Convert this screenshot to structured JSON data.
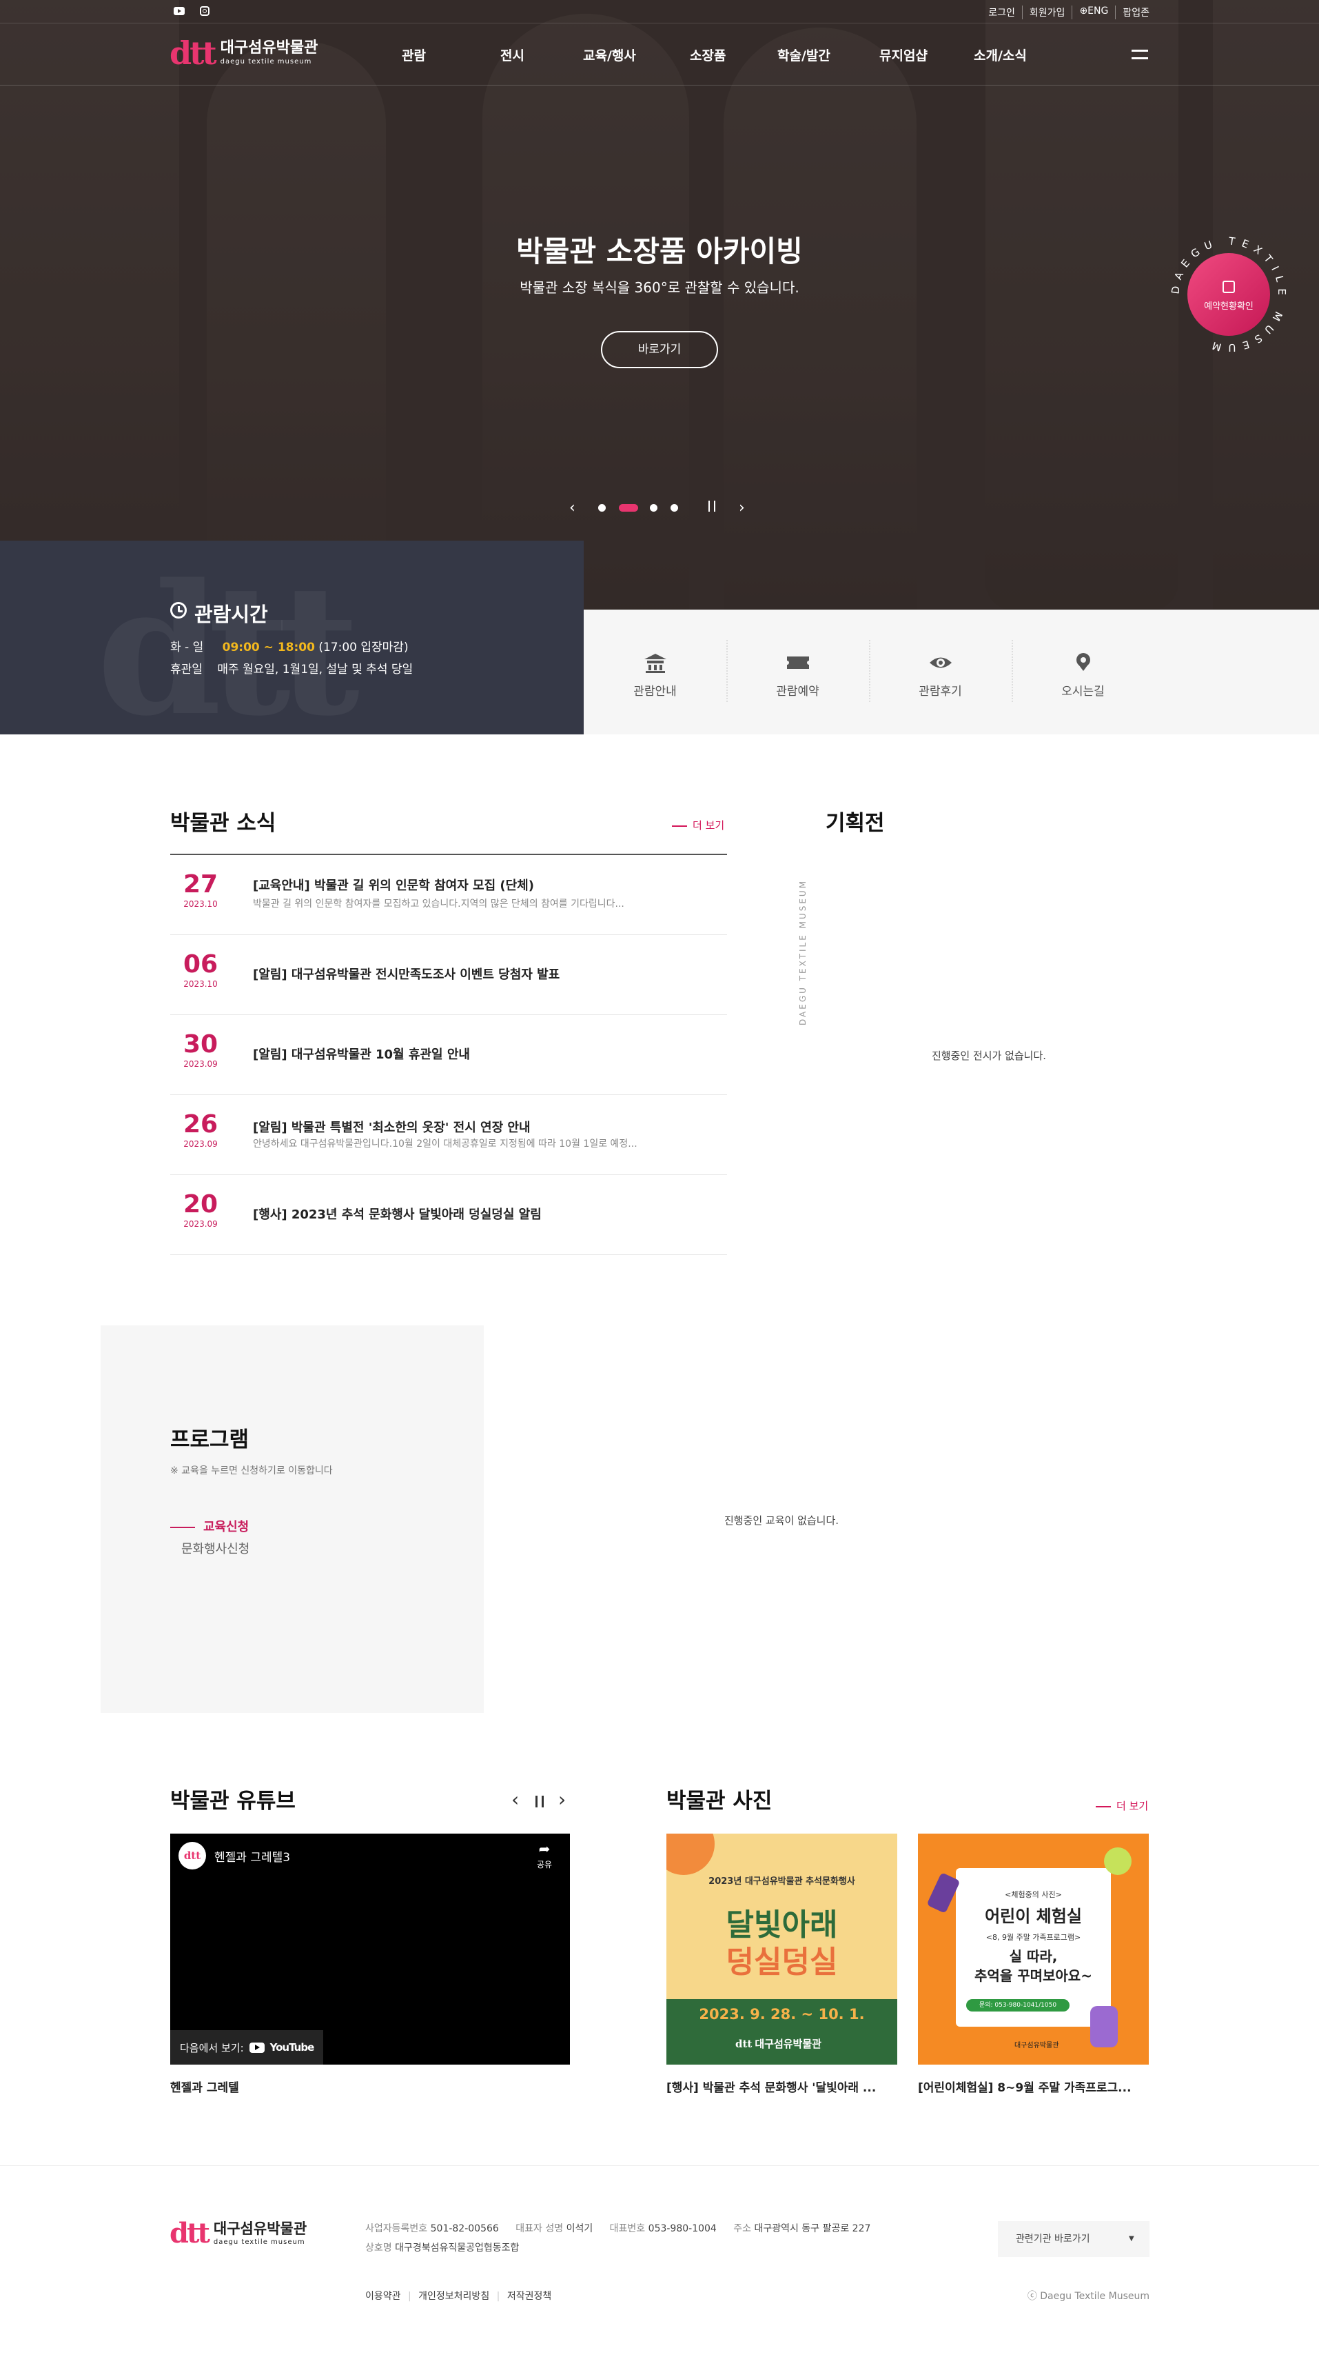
{
  "topbar": {
    "links": [
      "로그인",
      "회원가입",
      "⊕ENG",
      "팝업존"
    ],
    "sns": [
      "youtube-icon",
      "instagram-icon"
    ]
  },
  "brand": {
    "mark": "dtt",
    "name_ko": "대구섬유박물관",
    "name_en": "daegu textile museum",
    "accent": "#e8356f"
  },
  "gnb": {
    "items": [
      "관람",
      "전시",
      "교육/행사",
      "소장품",
      "학술/발간",
      "뮤지엄샵",
      "소개/소식"
    ]
  },
  "hero": {
    "title": "박물관 소장품 아카이빙",
    "subtitle": "박물관 소장 복식을 360°로 관찰할 수 있습니다.",
    "button": "바로가기",
    "badge_ring_text": "DAEGU TEXTILE MUSEUM",
    "badge_label": "예약현황확인",
    "slides_total": 4,
    "slide_active": 2
  },
  "hours": {
    "title": "관람시간",
    "days_label": "화 - 일",
    "time": "09:00 ~ 18:00",
    "time_note": "(17:00 입장마감)",
    "closed_label": "휴관일",
    "closed_text": "매주 월요일, 1월1일, 설날 및 추석 당일"
  },
  "quick": [
    {
      "label": "관람안내",
      "icon": "museum-icon"
    },
    {
      "label": "관람예약",
      "icon": "ticket-icon"
    },
    {
      "label": "관람후기",
      "icon": "eye-icon"
    },
    {
      "label": "오시는길",
      "icon": "location-pin-icon"
    }
  ],
  "news": {
    "title": "박물관 소식",
    "more": "더 보기",
    "items": [
      {
        "day": "27",
        "ym": "2023.10",
        "title": "[교육안내] 박물관 길 위의 인문학 참여자 모집 (단체)",
        "excerpt": "박물관 길 위의 인문학 참여자를 모집하고 있습니다.지역의 많은 단체의 참여를 기다립니다..."
      },
      {
        "day": "06",
        "ym": "2023.10",
        "title": "[알림] 대구섬유박물관 전시만족도조사 이벤트 당첨자 발표",
        "excerpt": ""
      },
      {
        "day": "30",
        "ym": "2023.09",
        "title": "[알림] 대구섬유박물관 10월 휴관일 안내",
        "excerpt": ""
      },
      {
        "day": "26",
        "ym": "2023.09",
        "title": "[알림] 박물관 특별전 '최소한의 옷장' 전시 연장 안내",
        "excerpt": "안녕하세요 대구섬유박물관입니다.10월 2일이 대체공휴일로 지정됨에 따라 10월 1일로 예정..."
      },
      {
        "day": "20",
        "ym": "2023.09",
        "title": "[행사] 2023년 추석 문화행사 달빛아래 덩실덩실 알림",
        "excerpt": ""
      }
    ]
  },
  "exhibit": {
    "title": "기획전",
    "vertical": "DAEGU TEXTILE MUSEUM",
    "empty": "진행중인 전시가 없습니다."
  },
  "program": {
    "title": "프로그램",
    "note": "※ 교육을 누르면 신청하기로 이동합니다",
    "tabs": [
      "교육신청",
      "문화행사신청"
    ],
    "empty": "진행중인 교육이 없습니다."
  },
  "youtube": {
    "title": "박물관 유튜브",
    "video_title": "헨젤과 그레텔3",
    "share": "공유",
    "watch_on": "다음에서 보기:",
    "yt_brand": "YouTube",
    "caption": "헨젤과 그레텔"
  },
  "photos": {
    "title": "박물관 사진",
    "more": "더 보기",
    "items": [
      {
        "caption": "[행사] 박물관 추석 문화행사 '달빛아래 ...",
        "poster_top": "2023년 대구섬유박물관 추석문화행사",
        "poster_title1": "달빛아래",
        "poster_title2": "덩실덩실",
        "poster_date": "2023. 9. 28. ~ 10. 1.",
        "poster_brand": "대구섬유박물관"
      },
      {
        "caption": "[어린이체험실] 8~9월 주말 가족프로그...",
        "poster_tag": "<체험중의 사진>",
        "poster_title": "어린이 체험실",
        "poster_sub": "<8, 9월 주말 가족프로그램>",
        "poster_line1": "실 따라,",
        "poster_line2": "추억을 꾸며보아요~",
        "poster_contact": "문의: 053-980-1041/1050",
        "poster_brand": "대구섬유박물관"
      }
    ]
  },
  "footer": {
    "biz_label": "사업자등록번호",
    "biz_no": "501-82-00566",
    "ceo_label": "대표자 성명",
    "ceo": "이석기",
    "tel_label": "대표번호",
    "tel": "053-980-1004",
    "addr_label": "주소",
    "addr": "대구광역시 동구 팔공로 227",
    "company_label": "상호명",
    "company": "대구경북섬유직물공업협동조합",
    "links": [
      "이용약관",
      "개인정보처리방침",
      "저작권정책"
    ],
    "related": "관련기관 바로가기",
    "copyright": "ⓒ Daegu Textile Museum"
  }
}
